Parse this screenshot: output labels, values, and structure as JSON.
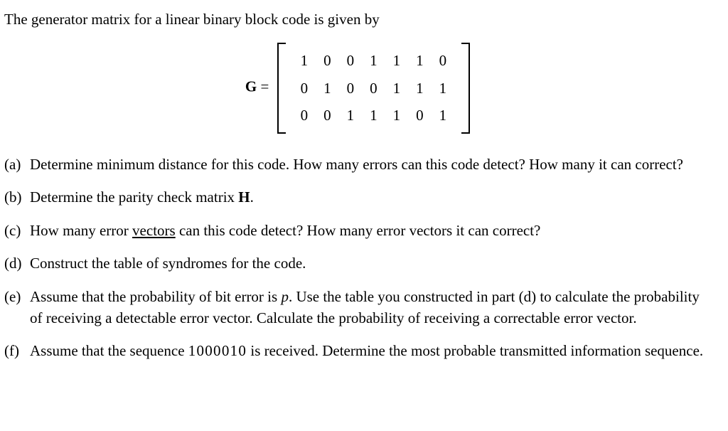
{
  "intro": "The generator matrix for a linear binary block code is given by",
  "matrix": {
    "label": "G",
    "rows": [
      [
        "1",
        "0",
        "0",
        "1",
        "1",
        "1",
        "0"
      ],
      [
        "0",
        "1",
        "0",
        "0",
        "1",
        "1",
        "1"
      ],
      [
        "0",
        "0",
        "1",
        "1",
        "1",
        "0",
        "1"
      ]
    ]
  },
  "parts": {
    "a": {
      "label": "(a)",
      "text1": "Determine minimum distance for this code. How many errors can this code detect? How many it can correct?"
    },
    "b": {
      "label": "(b)",
      "text_before": "Determine the parity check matrix ",
      "bold": "H",
      "text_after": "."
    },
    "c": {
      "label": "(c)",
      "text_before": "How many error ",
      "underlined": "vectors",
      "text_after": " can this code detect? How many error vectors it can correct?"
    },
    "d": {
      "label": "(d)",
      "text1": "Construct the table of syndromes for the code."
    },
    "e": {
      "label": "(e)",
      "text_before": "Assume that the probability of bit error is ",
      "p": "p",
      "text_mid": ". Use the table you constructed in part (d) to calculate the probability of receiving a detectable error vector. Calculate the probability of receiving a correctable error vector."
    },
    "f": {
      "label": "(f)",
      "text_before": "Assume that the sequence ",
      "seq": "1000010",
      "text_after": " is received. Determine the most probable transmitted information sequence."
    }
  }
}
